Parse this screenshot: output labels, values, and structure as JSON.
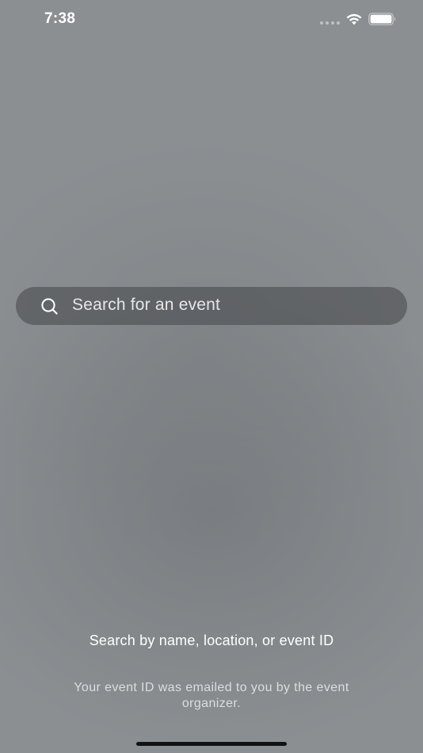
{
  "status_bar": {
    "time": "7:38",
    "icons": [
      "signal-dots-icon",
      "wifi-icon",
      "battery-icon"
    ]
  },
  "search": {
    "placeholder": "Search for an event",
    "icon": "search-icon"
  },
  "hint": {
    "title": "Search by name, location, or event ID",
    "subtitle": "Your event ID was emailed to you by the event organizer."
  },
  "colors": {
    "background": "#8b8f92",
    "search_bar": "#5d6063",
    "text_primary": "#ffffff",
    "text_secondary": "#dcdde0",
    "home_indicator": "#111214"
  }
}
